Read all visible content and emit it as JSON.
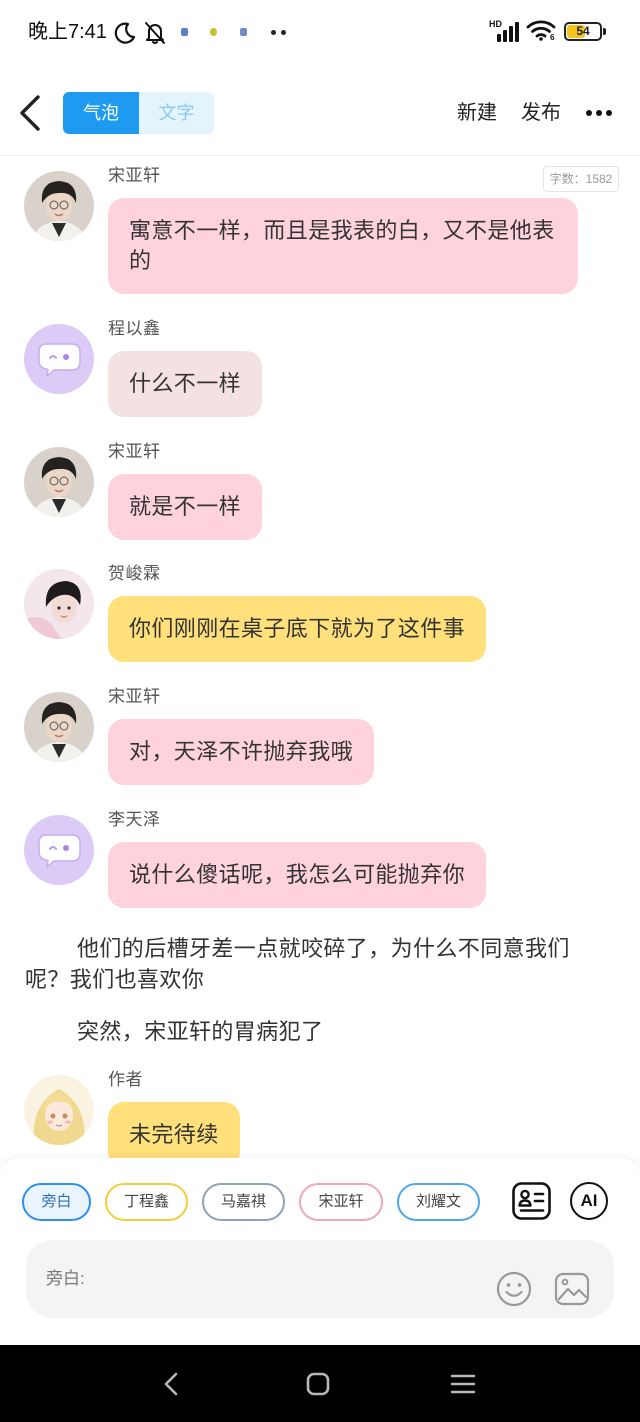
{
  "status_bar": {
    "time": "晚上7:41",
    "network_label": "HD",
    "wifi_label": "6",
    "battery": {
      "label": "54",
      "level": 54,
      "color": "#f6c21c"
    },
    "icons": [
      "moon-icon",
      "bell-off-icon",
      "notification-icon",
      "notification-icon",
      "notification-icon",
      "more-notifications-icon",
      "signal-icon",
      "wifi-icon",
      "battery-icon"
    ]
  },
  "header": {
    "back_icon": "chevron-left-icon",
    "tabs": [
      {
        "label": "气泡",
        "active": true
      },
      {
        "label": "文字",
        "active": false
      }
    ],
    "new_label": "新建",
    "publish_label": "发布",
    "more_icon": "more-horizontal-icon",
    "accent_color": "#1e9bf0"
  },
  "chat": {
    "word_count": "字数：1582",
    "items": [
      {
        "name": "宋亚轩",
        "text": "寓意不一样，而且是我表的白，又不是他表的",
        "avatar": "photo-avatar-a",
        "bubble_color": "#ffd3de"
      },
      {
        "name": "程以鑫",
        "text": "什么不一样",
        "avatar": "default-chat-avatar",
        "bubble_color": "#f4e1e1"
      },
      {
        "name": "宋亚轩",
        "text": "就是不一样",
        "avatar": "photo-avatar-a",
        "bubble_color": "#ffd3de"
      },
      {
        "name": "贺峻霖",
        "text": "你们刚刚在桌子底下就为了这件事",
        "avatar": "photo-avatar-b",
        "bubble_color": "#ffe07b"
      },
      {
        "name": "宋亚轩",
        "text": "对，天泽不许抛弃我哦",
        "avatar": "photo-avatar-a",
        "bubble_color": "#ffd3de"
      },
      {
        "name": "李天泽",
        "text": "说什么傻话呢，我怎么可能抛弃你",
        "avatar": "default-chat-avatar",
        "bubble_color": "#ffd3de"
      },
      {
        "text": "他们的后槽牙差一点就咬碎了，为什么不同意我们呢？我们也喜欢你"
      },
      {
        "text": "突然，宋亚轩的胃病犯了"
      },
      {
        "name": "作者",
        "text": "未完待续",
        "avatar": "illustrated-avatar",
        "bubble_color": "#ffe07b"
      }
    ]
  },
  "composer": {
    "characters": [
      {
        "label": "旁白",
        "color": "#2d8ff0",
        "selected": true
      },
      {
        "label": "丁程鑫",
        "color": "#f4cd3d",
        "selected": false
      },
      {
        "label": "马嘉祺",
        "color": "#8ea2b8",
        "selected": false
      },
      {
        "label": "宋亚轩",
        "color": "#eea6ba",
        "selected": false
      },
      {
        "label": "刘耀文",
        "color": "#4ea7ea",
        "selected": false
      }
    ],
    "character_card_icon": "character-card-icon",
    "ai_label": "AI",
    "placeholder": "旁白:",
    "emoji_icon": "emoji-icon",
    "image_icon": "image-icon"
  },
  "nav_bar": {
    "icons": [
      "back-icon",
      "home-icon",
      "menu-icon"
    ]
  }
}
